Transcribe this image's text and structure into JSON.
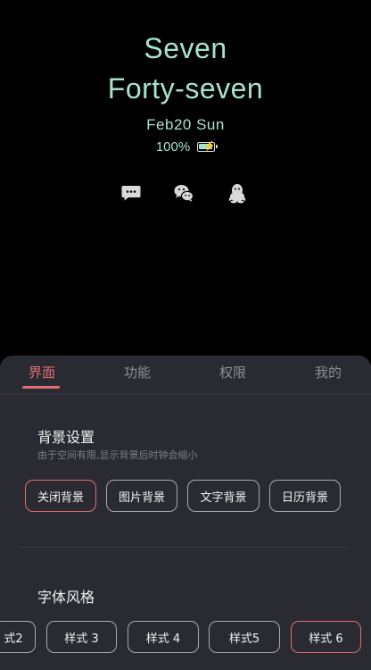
{
  "clock": {
    "hour_text": "Seven",
    "minute_text": "Forty-seven",
    "date_text": "Feb20 Sun",
    "battery_text": "100%",
    "accent_color": "#a6e3cf"
  },
  "shortcuts": [
    {
      "icon": "message-bubble-icon"
    },
    {
      "icon": "wechat-icon"
    },
    {
      "icon": "qq-penguin-icon"
    }
  ],
  "tabs": [
    {
      "label": "界面",
      "active": true
    },
    {
      "label": "功能",
      "active": false
    },
    {
      "label": "权限",
      "active": false
    },
    {
      "label": "我的",
      "active": false
    }
  ],
  "background_settings": {
    "title": "背景设置",
    "subtitle": "由于空间有限,显示背景后时钟会缩小",
    "options": [
      {
        "label": "关闭背景",
        "selected": true
      },
      {
        "label": "图片背景",
        "selected": false
      },
      {
        "label": "文字背景",
        "selected": false
      },
      {
        "label": "日历背景",
        "selected": false
      }
    ]
  },
  "font_style": {
    "title": "字体风格",
    "options": [
      {
        "label": "式2",
        "selected": false
      },
      {
        "label": "样式 3",
        "selected": false
      },
      {
        "label": "样式 4",
        "selected": false
      },
      {
        "label": "样式5",
        "selected": false
      },
      {
        "label": "样式 6",
        "selected": true
      }
    ]
  },
  "colors": {
    "panel_bg": "#2a2a33",
    "tab_active": "#e36d73",
    "tab_inactive": "#8e8e98"
  }
}
